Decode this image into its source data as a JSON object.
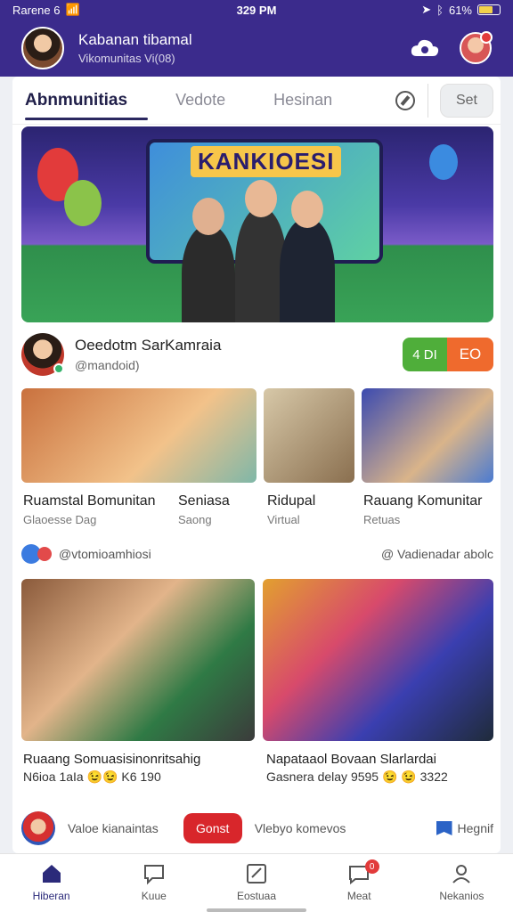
{
  "status": {
    "carrier": "Rarene 6",
    "time": "329 PM",
    "battery": "61%",
    "battery_level": 0.61
  },
  "header": {
    "title": "Kabanan tibamal",
    "subtitle": "Vikomunitas Vi(08)"
  },
  "tabs": [
    {
      "label": "Abnmunitias",
      "active": true
    },
    {
      "label": "Vedote",
      "active": false
    },
    {
      "label": "Hesinan",
      "active": false
    }
  ],
  "set_button": "Set",
  "hero": {
    "banner": "KANKIOESI"
  },
  "creator": {
    "name": "Oeedotm SarKamraia",
    "handle": "@mandoid)",
    "btn_a": "4 DI",
    "btn_b": "EO"
  },
  "thumbs": [
    {
      "title": "Ruamstal Bomunitan",
      "sub": "Glaoesse Dag"
    },
    {
      "title": "Seniasa",
      "sub": "Saong"
    },
    {
      "title": "Ridupal",
      "sub": "Virtual"
    },
    {
      "title": "Rauang Komunitar",
      "sub": "Retuas"
    }
  ],
  "community_row": {
    "handle": "@vtomioamhiosi",
    "right": "@ Vadienadar abolc"
  },
  "big_cards": [
    {
      "title": "Ruaang Somuasisinonritsahig",
      "sub": "N6ioa 1aIa  😉😉 K6 190"
    },
    {
      "title": "Napataaol Bovaan Slarlardai",
      "sub": "Gasnera delay  9595 😉 😉 3322"
    }
  ],
  "footer_row": {
    "label": "Valoe kianaintas",
    "button": "Gonst",
    "label2": "Vlebyo komevos",
    "right": "Hegnif"
  },
  "bottom_nav": [
    {
      "label": "Hiberan",
      "active": true
    },
    {
      "label": "Kuue",
      "active": false
    },
    {
      "label": "Eostuaa",
      "active": false
    },
    {
      "label": "Meat",
      "active": false,
      "badge": "0"
    },
    {
      "label": "Nekanios",
      "active": false
    }
  ]
}
